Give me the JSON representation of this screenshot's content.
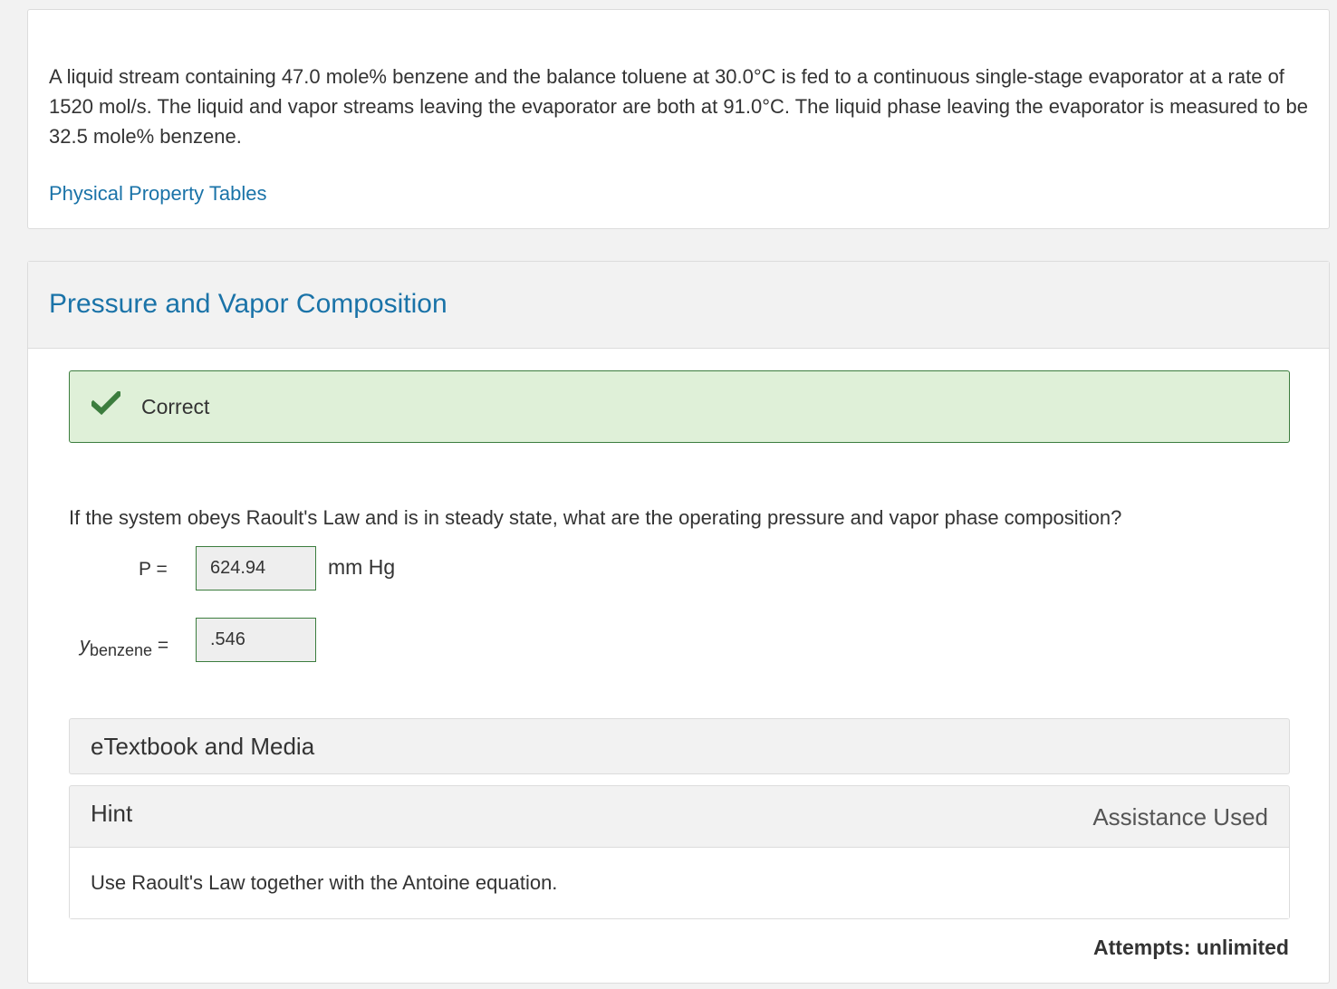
{
  "problem": {
    "text": "A liquid stream containing 47.0 mole% benzene and the balance toluene at 30.0°C is fed to a continuous single-stage evaporator at a rate of 1520 mol/s. The liquid and vapor streams leaving the evaporator are both at 91.0°C. The liquid phase leaving the evaporator is measured to be 32.5 mole% benzene.",
    "link_label": "Physical Property Tables"
  },
  "part": {
    "title": "Pressure and Vapor Composition",
    "feedback": {
      "status": "Correct",
      "icon": "checkmark-icon",
      "color": "#3c7d3e",
      "background": "#dff0d8"
    },
    "question": "If the system obeys Raoult's Law and is in steady state, what are the operating pressure and vapor phase composition?",
    "inputs": [
      {
        "label": "P =",
        "value": "624.94",
        "unit": "mm Hg"
      },
      {
        "label_var": "y",
        "label_sub": "benzene",
        "label_eq": "=",
        "value": ".546",
        "unit": ""
      }
    ],
    "etextbook_label": "eTextbook and Media",
    "hint": {
      "title": "Hint",
      "status": "Assistance Used",
      "text": "Use Raoult's Law together with the Antoine equation."
    },
    "attempts": {
      "label": "Attempts:",
      "value": "unlimited"
    }
  },
  "colors": {
    "link": "#1a73a8",
    "page_background": "#f2f2f2",
    "correct_border": "#3c7d3e"
  }
}
